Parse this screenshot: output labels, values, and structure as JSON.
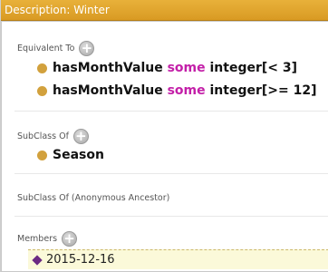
{
  "title": "Description: Winter",
  "sections": {
    "equivalent_to": {
      "label": "Equivalent To",
      "rows": [
        {
          "property": "hasMonthValue",
          "keyword": "some",
          "filler": "integer[< 3]"
        },
        {
          "property": "hasMonthValue",
          "keyword": "some",
          "filler": "integer[>= 12]"
        }
      ]
    },
    "subclass_of": {
      "label": "SubClass Of",
      "rows": [
        {
          "value": "Season"
        }
      ]
    },
    "subclass_of_anonymous": {
      "label": "SubClass Of (Anonymous Ancestor)"
    },
    "members": {
      "label": "Members",
      "rows": [
        {
          "value": "2015-12-16"
        }
      ]
    }
  },
  "icons": {
    "add": "plus-circle-icon",
    "class_bullet": "class-dot-icon",
    "individual_bullet": "individual-diamond-icon"
  },
  "colors": {
    "title_bar": "#d99a23",
    "keyword": "#c31fa8",
    "class_dot": "#d2a13d",
    "individual": "#6b2a83",
    "member_highlight": "#fbf9d9"
  }
}
